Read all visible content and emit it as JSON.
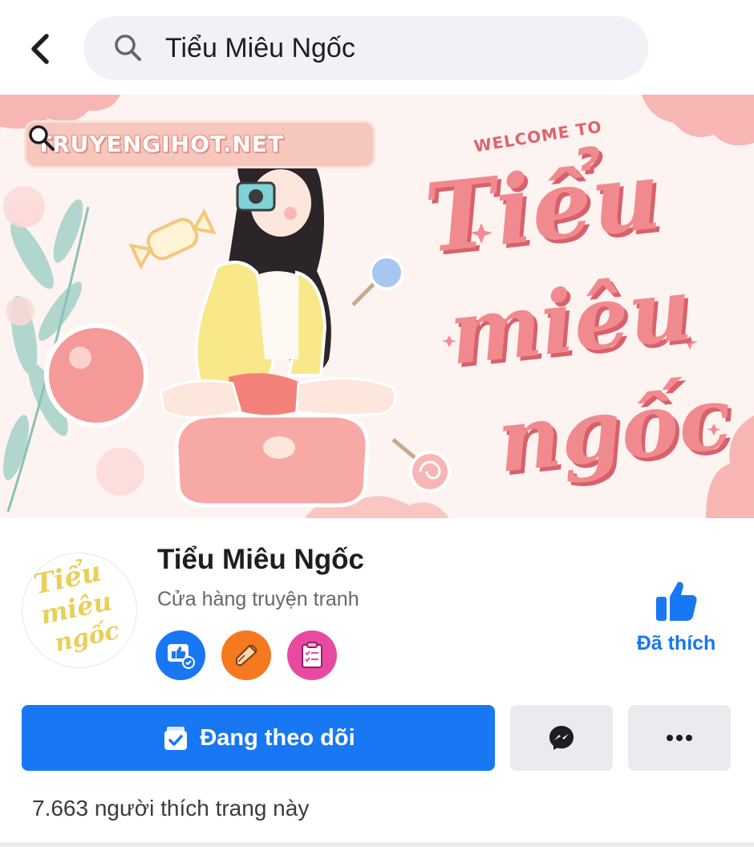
{
  "search": {
    "query": "Tiểu Miêu Ngốc"
  },
  "cover": {
    "site_text": "TRUYENGIHOT.NET",
    "welcome_text": "WELCOME TO",
    "title_lines": [
      "Tiểu",
      "miêu",
      "ngốc"
    ]
  },
  "profile": {
    "avatar_lines": [
      "Tiểu",
      "miêu",
      "ngốc"
    ],
    "name": "Tiểu Miêu Ngốc",
    "category": "Cửa hàng truyện tranh",
    "badges": [
      "thumbs-up-badge-icon",
      "megaphone-badge-icon",
      "clipboard-badge-icon"
    ],
    "liked_label": "Đã thích"
  },
  "actions": {
    "follow_label": "Đang theo dõi",
    "messenger_icon": "messenger-icon",
    "more_icon": "more-dots-icon"
  },
  "stats": {
    "likes_text": "7.663 người thích trang này"
  },
  "colors": {
    "facebook_blue": "#1877f2",
    "cover_pink": "#f08a8e",
    "avatar_gold": "#e9cf5a"
  }
}
